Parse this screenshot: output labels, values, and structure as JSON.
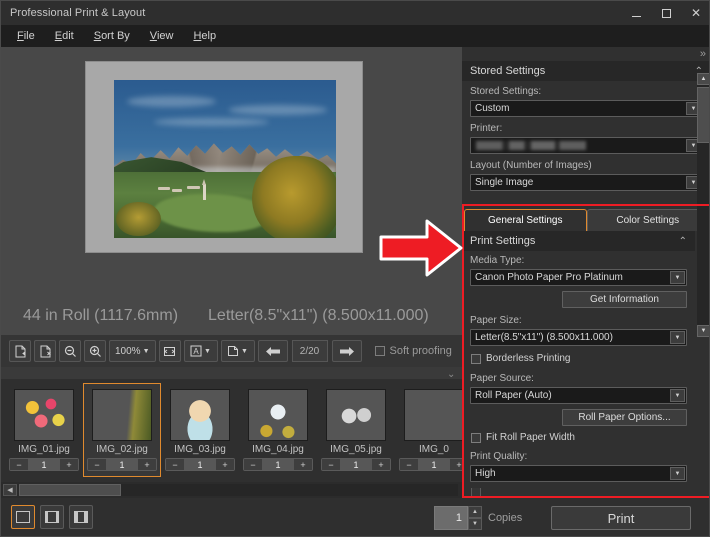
{
  "window": {
    "title": "Professional Print & Layout",
    "minimize_icon": "minimize-icon",
    "maximize_icon": "maximize-icon",
    "close_icon": "close-icon",
    "close_label": "✕"
  },
  "menu": {
    "items": [
      {
        "label": "File",
        "accel": "F"
      },
      {
        "label": "Edit",
        "accel": "E"
      },
      {
        "label": "Sort By",
        "accel": "S"
      },
      {
        "label": "View",
        "accel": "V"
      },
      {
        "label": "Help",
        "accel": "H"
      }
    ]
  },
  "preview": {
    "roll_info": "44 in Roll (1117.6mm)",
    "paper_info": "Letter(8.5\"x11\") (8.500x11.000)"
  },
  "toolbar": {
    "add_page_icon": "add-page-icon",
    "delete_page_icon": "delete-page-icon",
    "zoom_out_icon": "zoom-out-icon",
    "zoom_in_icon": "zoom-in-icon",
    "zoom_level": "100%",
    "fit_icon": "fit-to-window-icon",
    "text_tool_icon": "text-tool-icon",
    "text_tool_label": "A",
    "page_tool_icon": "page-tool-icon",
    "prev_icon": "previous-page-icon",
    "next_icon": "next-page-icon",
    "page_indicator": "2/20",
    "soft_proofing_label": "Soft proofing",
    "soft_proofing_checked": false,
    "collapse_chevron": "chevron-down-icon"
  },
  "filmstrip": {
    "items": [
      {
        "name": "IMG_01.jpg",
        "count": "1",
        "selected": false
      },
      {
        "name": "IMG_02.jpg",
        "count": "1",
        "selected": true
      },
      {
        "name": "IMG_03.jpg",
        "count": "1",
        "selected": false
      },
      {
        "name": "IMG_04.jpg",
        "count": "1",
        "selected": false
      },
      {
        "name": "IMG_05.jpg",
        "count": "1",
        "selected": false
      },
      {
        "name": "IMG_0",
        "count": "1",
        "selected": false
      }
    ],
    "decrement_label": "−",
    "increment_label": "+"
  },
  "stored_settings": {
    "section_title": "Stored Settings",
    "collapse_chevron": "chevron-up-icon",
    "expand_icon": "expand-panel-icon",
    "stored_settings_label": "Stored Settings:",
    "stored_settings_value": "Custom",
    "printer_label": "Printer:",
    "printer_value": "",
    "layout_label": "Layout (Number of Images)",
    "layout_value": "Single Image"
  },
  "tabs": {
    "general": "General Settings",
    "color": "Color Settings",
    "active": "General Settings"
  },
  "print_settings": {
    "section_title": "Print Settings",
    "collapse_chevron": "chevron-up-icon",
    "media_type_label": "Media Type:",
    "media_type_value": "Canon Photo Paper Pro Platinum",
    "get_information_label": "Get Information",
    "paper_size_label": "Paper Size:",
    "paper_size_value": "Letter(8.5\"x11\") (8.500x11.000)",
    "borderless_label": "Borderless Printing",
    "borderless_checked": false,
    "paper_source_label": "Paper Source:",
    "paper_source_value": "Roll Paper (Auto)",
    "roll_paper_options_label": "Roll Paper Options...",
    "fit_roll_width_label": "Fit Roll Paper Width",
    "fit_roll_width_checked": false,
    "print_quality_label": "Print Quality:",
    "print_quality_value": "High"
  },
  "bottom": {
    "view_single_icon": "view-single-icon",
    "view_double_icon": "view-double-icon",
    "view_triple_icon": "view-triple-icon",
    "copies_value": "1",
    "copies_label": "Copies",
    "print_label": "Print"
  },
  "colors": {
    "accent_orange": "#e08a2e",
    "annotation_red": "#ee1c24",
    "panel_bg": "#303030",
    "window_bg": "#3a3a3a"
  }
}
